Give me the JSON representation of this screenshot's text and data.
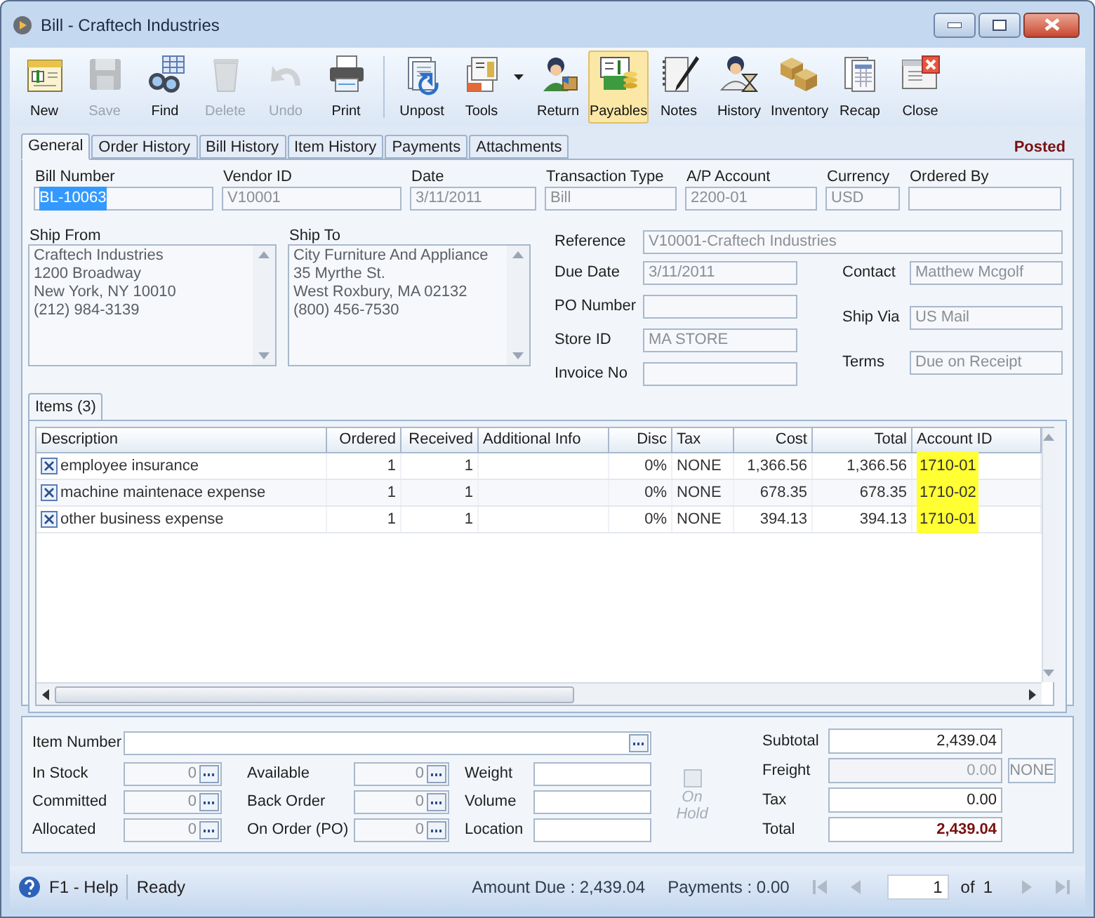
{
  "window": {
    "title": "Bill - Craftech Industries"
  },
  "toolbar": [
    {
      "label": "New",
      "disabled": false,
      "selected": false,
      "dropdown": false
    },
    {
      "label": "Save",
      "disabled": true,
      "selected": false,
      "dropdown": false
    },
    {
      "label": "Find",
      "disabled": false,
      "selected": false,
      "dropdown": false
    },
    {
      "label": "Delete",
      "disabled": true,
      "selected": false,
      "dropdown": false
    },
    {
      "label": "Undo",
      "disabled": true,
      "selected": false,
      "dropdown": false
    },
    {
      "label": "Print",
      "disabled": false,
      "selected": false,
      "dropdown": false
    },
    {
      "label": "Unpost",
      "disabled": false,
      "selected": false,
      "dropdown": false
    },
    {
      "label": "Tools",
      "disabled": false,
      "selected": false,
      "dropdown": true
    },
    {
      "label": "Return",
      "disabled": false,
      "selected": false,
      "dropdown": false
    },
    {
      "label": "Payables",
      "disabled": false,
      "selected": true,
      "dropdown": false
    },
    {
      "label": "Notes",
      "disabled": false,
      "selected": false,
      "dropdown": false
    },
    {
      "label": "History",
      "disabled": false,
      "selected": false,
      "dropdown": false
    },
    {
      "label": "Inventory",
      "disabled": false,
      "selected": false,
      "dropdown": false
    },
    {
      "label": "Recap",
      "disabled": false,
      "selected": false,
      "dropdown": false
    },
    {
      "label": "Close",
      "disabled": false,
      "selected": false,
      "dropdown": false
    }
  ],
  "tabs": [
    {
      "label": "General",
      "selected": true
    },
    {
      "label": "Order History",
      "selected": false
    },
    {
      "label": "Bill History",
      "selected": false
    },
    {
      "label": "Item History",
      "selected": false
    },
    {
      "label": "Payments",
      "selected": false
    },
    {
      "label": "Attachments",
      "selected": false
    }
  ],
  "status_badge": "Posted",
  "header_fields": [
    {
      "label": "Bill Number",
      "value": "BL-10063",
      "text_selected": true
    },
    {
      "label": "Vendor ID",
      "value": "V10001",
      "text_selected": false
    },
    {
      "label": "Date",
      "value": "3/11/2011",
      "text_selected": false
    },
    {
      "label": "Transaction Type",
      "value": "Bill",
      "text_selected": false
    },
    {
      "label": "A/P Account",
      "value": "2200-01",
      "text_selected": false
    },
    {
      "label": "Currency",
      "value": "USD",
      "text_selected": false
    },
    {
      "label": "Ordered By",
      "text_selected": false
    }
  ],
  "ship_from": {
    "label": "Ship From",
    "lines": [
      "Craftech Industries",
      "1200 Broadway",
      "New York, NY 10010",
      "(212) 984-3139"
    ]
  },
  "ship_to": {
    "label": "Ship To",
    "lines": [
      "City Furniture And Appliance",
      "35 Myrthe St.",
      "West Roxbury, MA 02132",
      "(800) 456-7530"
    ]
  },
  "reference": {
    "label": "Reference",
    "value": "V10001-Craftech Industries"
  },
  "left_fields": [
    {
      "label": "Due Date",
      "value": "3/11/2011"
    },
    {
      "label": "PO Number"
    },
    {
      "label": "Store ID",
      "value": "MA STORE"
    },
    {
      "label": "Invoice No"
    }
  ],
  "right_fields": [
    {
      "label": "Contact",
      "value": "Matthew Mcgolf"
    },
    {
      "label": "Ship Via",
      "value": "US Mail"
    },
    {
      "label": "Terms",
      "value": "Due on Receipt"
    }
  ],
  "items_tab": {
    "label": "Items (3)"
  },
  "grid": {
    "columns": [
      {
        "label": "Description",
        "highlighted": false
      },
      {
        "label": "Ordered",
        "highlighted": false
      },
      {
        "label": "Received",
        "highlighted": false
      },
      {
        "label": "Additional Info",
        "highlighted": false
      },
      {
        "label": "Disc",
        "highlighted": false
      },
      {
        "label": "Tax",
        "highlighted": false
      },
      {
        "label": "Cost",
        "highlighted": false
      },
      {
        "label": "Total",
        "highlighted": false
      },
      {
        "label": "Account ID",
        "highlighted": true
      }
    ],
    "rows": [
      {
        "cells": [
          "employee insurance",
          "1",
          "1",
          "",
          "0%",
          "NONE",
          "1,366.56",
          "1,366.56",
          "1710-01"
        ]
      },
      {
        "cells": [
          "machine maintenace expense",
          "1",
          "1",
          "",
          "0%",
          "NONE",
          "678.35",
          "678.35",
          "1710-02"
        ]
      },
      {
        "cells": [
          "other business expense",
          "1",
          "1",
          "",
          "0%",
          "NONE",
          "394.13",
          "394.13",
          "1710-01"
        ]
      }
    ]
  },
  "item_panel": {
    "item_number": {
      "label": "Item Number"
    },
    "stock_fields": [
      {
        "label": "In Stock",
        "value": "0"
      },
      {
        "label": "Available",
        "value": "0"
      },
      {
        "label": "Committed",
        "value": "0"
      },
      {
        "label": "Back Order",
        "value": "0"
      },
      {
        "label": "Allocated",
        "value": "0"
      },
      {
        "label": "On Order (PO)",
        "value": "0"
      }
    ],
    "other_fields": [
      {
        "label": "Weight"
      },
      {
        "label": "Volume"
      },
      {
        "label": "Location"
      }
    ],
    "on_hold": {
      "label": "On Hold",
      "checked": false,
      "disabled": true
    }
  },
  "totals": [
    {
      "label": "Subtotal",
      "value": "2,439.04",
      "kind": "plain",
      "disabled": false
    },
    {
      "label": "Freight",
      "value": "0.00",
      "kind": "with_code",
      "code": "NONE",
      "disabled": true
    },
    {
      "label": "Tax",
      "value": "0.00",
      "kind": "plain",
      "disabled": false
    },
    {
      "label": "Total",
      "value": "2,439.04",
      "kind": "total",
      "disabled": false
    }
  ],
  "status_bar": {
    "help": "F1 - Help",
    "state": "Ready",
    "amount_due": "Amount Due : 2,439.04",
    "payments": "Payments : 0.00",
    "page": "1",
    "of": "of",
    "page_count": "1"
  }
}
